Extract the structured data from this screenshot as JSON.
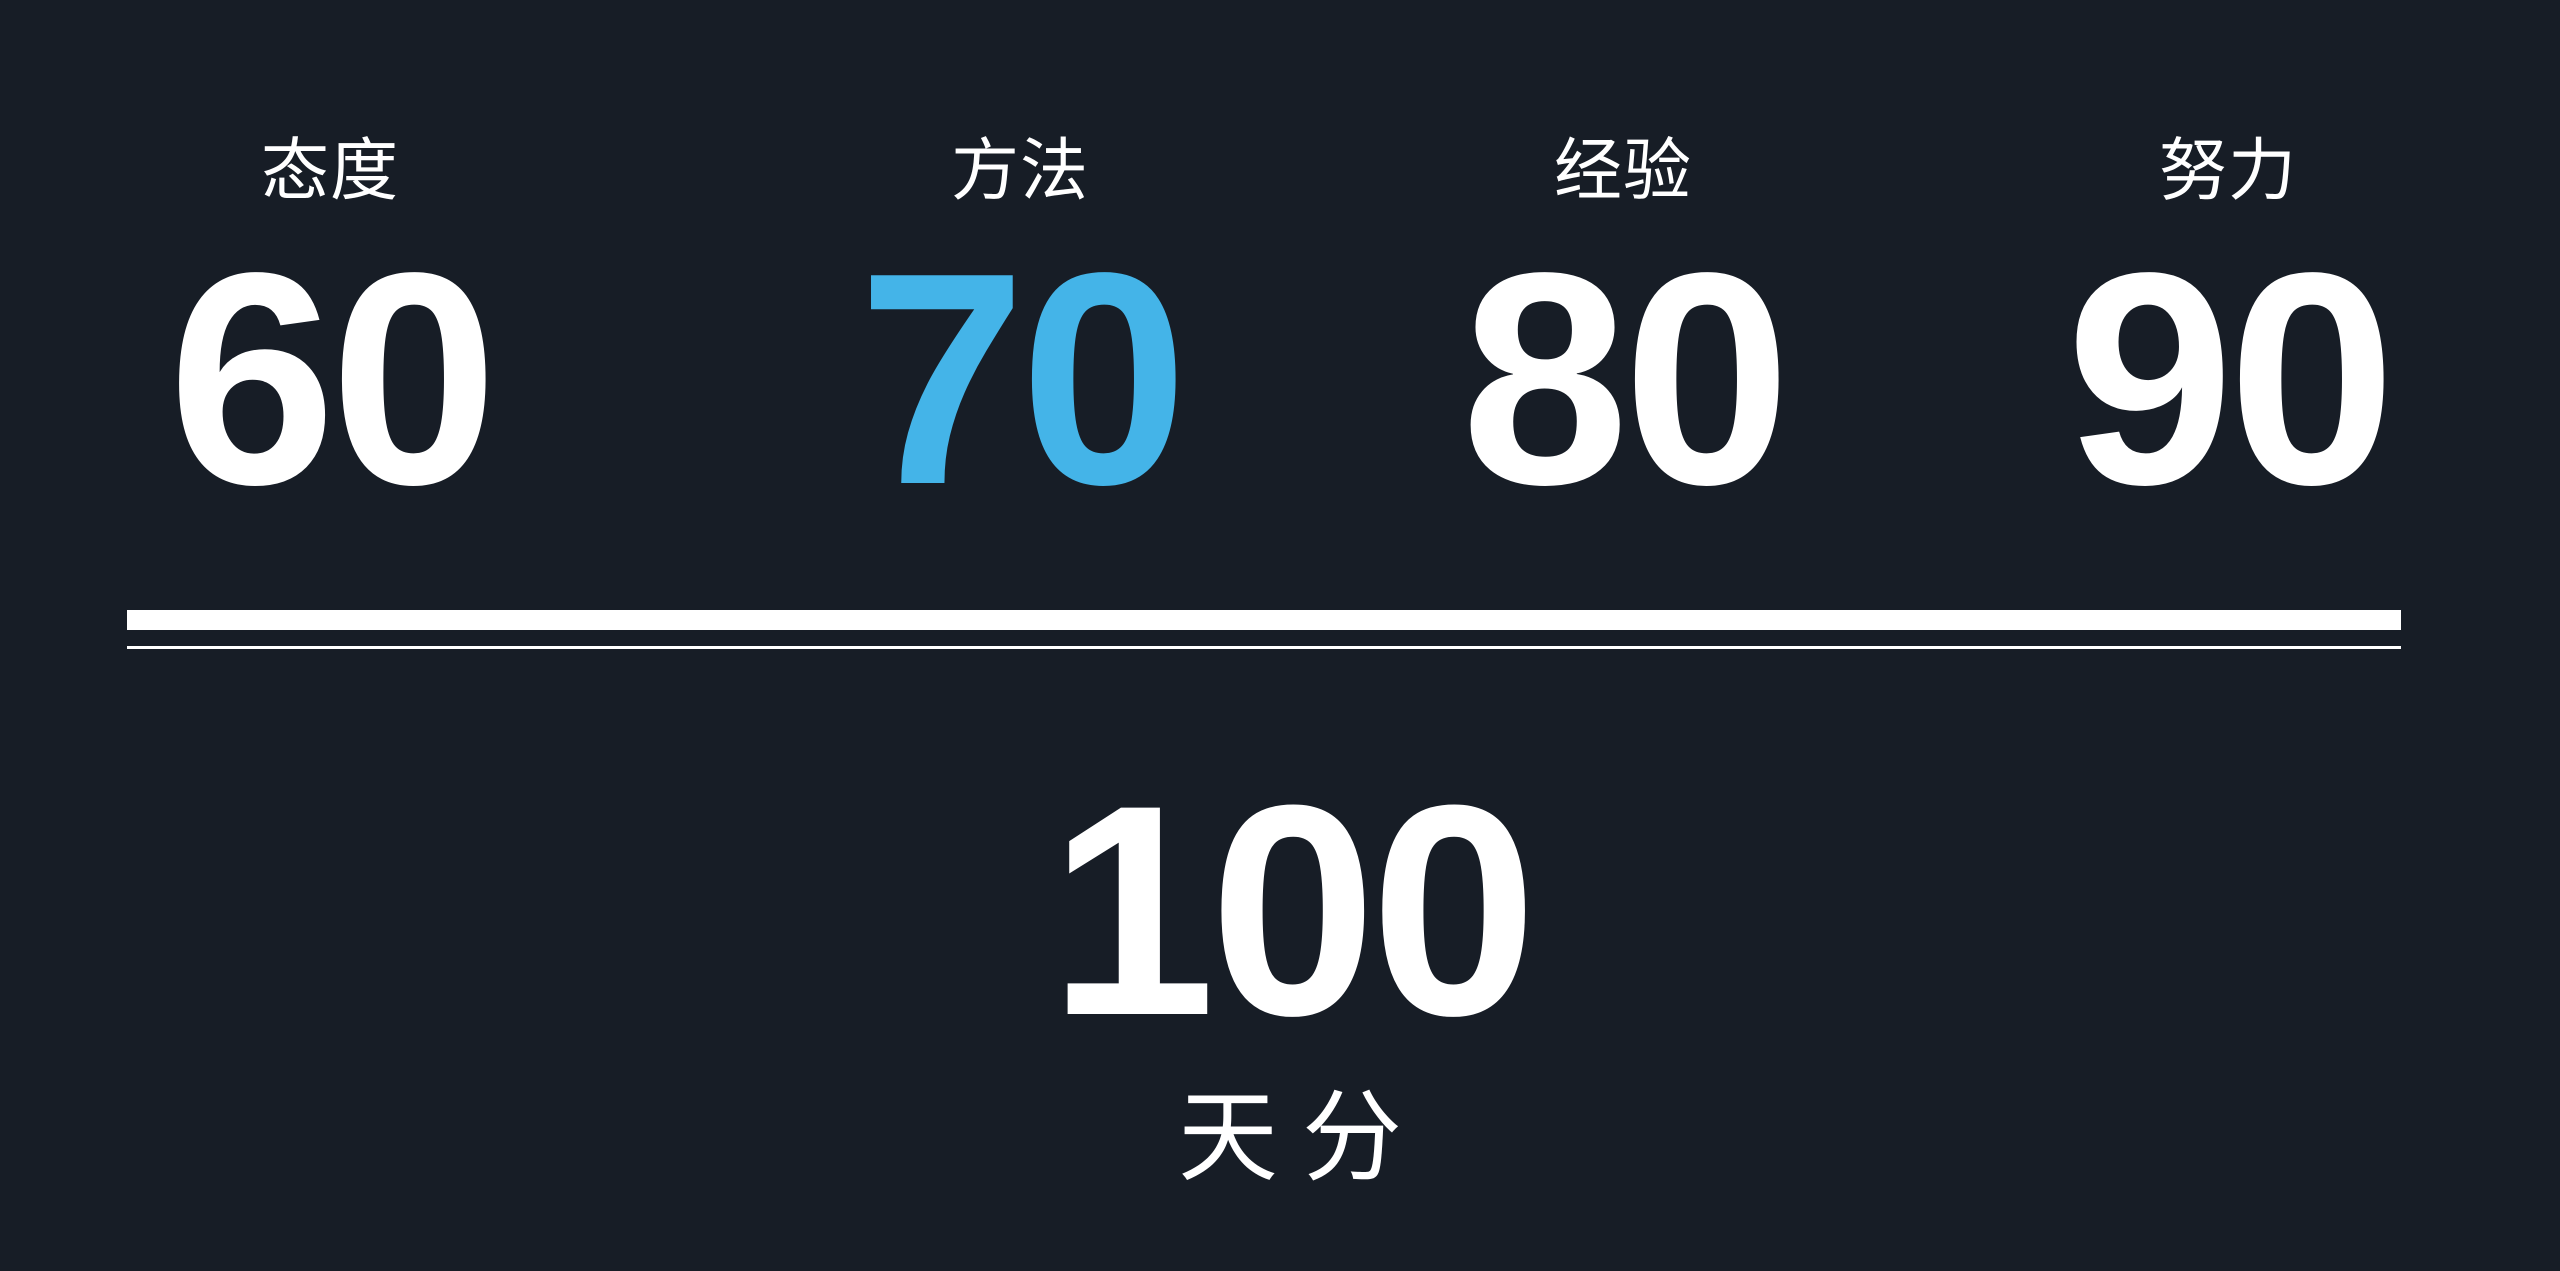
{
  "metrics": [
    {
      "label": "态度",
      "value": "60",
      "color": "#ffffff"
    },
    {
      "label": "方法",
      "value": "70",
      "color": "#44b4e8"
    },
    {
      "label": "经验",
      "value": "80",
      "color": "#ffffff"
    },
    {
      "label": "努力",
      "value": "90",
      "color": "#ffffff"
    }
  ],
  "total": {
    "value": "100",
    "label": "天分"
  },
  "colors": {
    "background": "#171d26",
    "text": "#ffffff",
    "accent": "#44b4e8"
  }
}
